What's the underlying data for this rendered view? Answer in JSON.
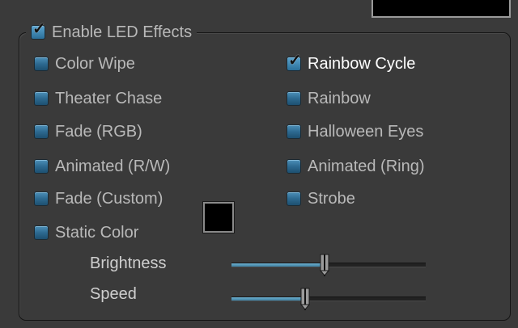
{
  "colors": {
    "background": "#3a3a3a",
    "text": "#b9b9b9",
    "checkbox_accent": "#3f86b1",
    "swatch": "#000000"
  },
  "group": {
    "enable_label": "Enable LED Effects",
    "enable_checked": true
  },
  "effects_left": [
    {
      "label": "Color Wipe",
      "checked": false
    },
    {
      "label": "Theater Chase",
      "checked": false
    },
    {
      "label": "Fade (RGB)",
      "checked": false
    },
    {
      "label": "Animated (R/W)",
      "checked": false
    },
    {
      "label": "Fade (Custom)",
      "checked": false
    },
    {
      "label": "Static Color",
      "checked": false
    }
  ],
  "effects_right": [
    {
      "label": "Rainbow Cycle",
      "checked": true
    },
    {
      "label": "Rainbow",
      "checked": false
    },
    {
      "label": "Halloween Eyes",
      "checked": false
    },
    {
      "label": "Animated (Ring)",
      "checked": false
    },
    {
      "label": "Strobe",
      "checked": false
    }
  ],
  "sliders": {
    "brightness": {
      "label": "Brightness",
      "level": 0.48
    },
    "speed": {
      "label": "Speed",
      "level": 0.38
    }
  },
  "icons": {
    "check": "check-icon",
    "swatch": "color-swatch"
  }
}
